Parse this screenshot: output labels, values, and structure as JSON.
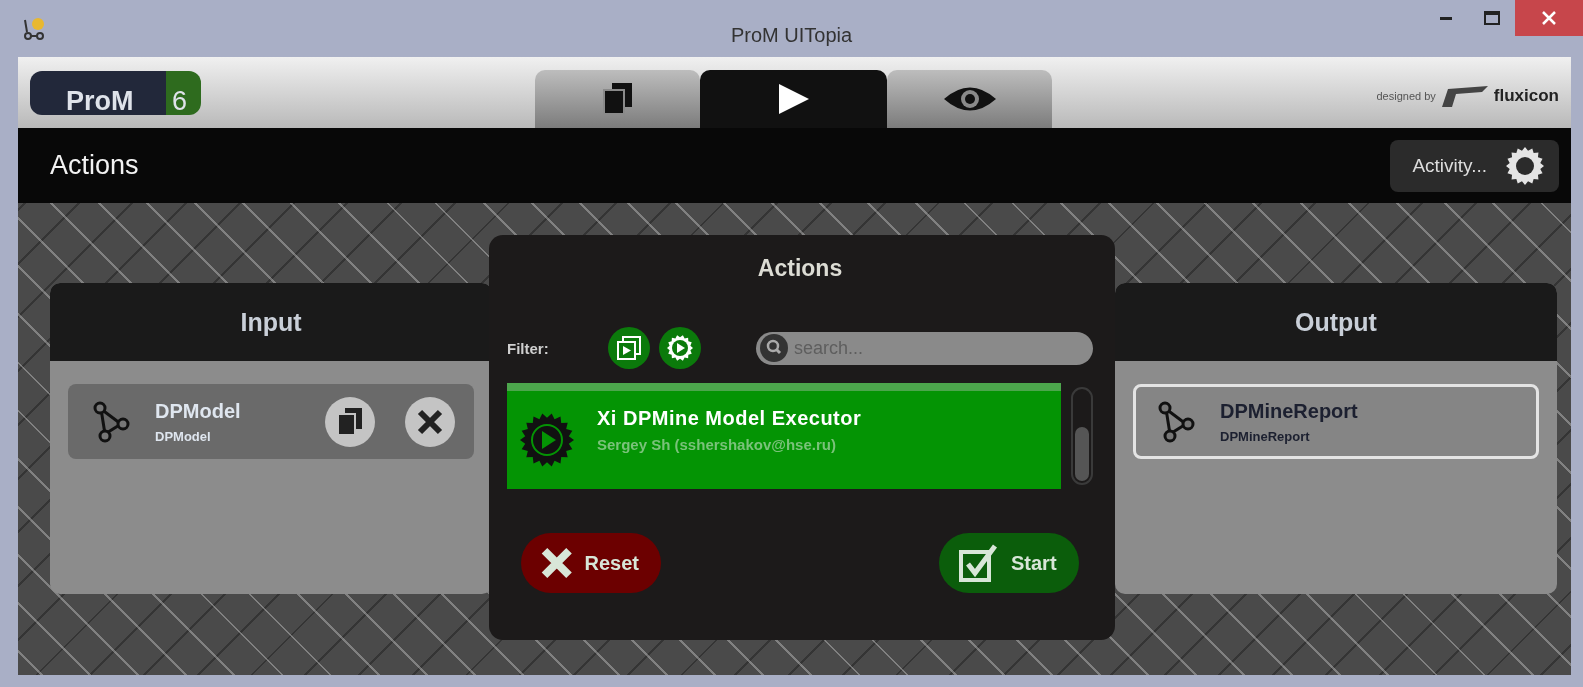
{
  "window": {
    "title": "ProM UITopia"
  },
  "logo": {
    "name": "ProM",
    "version": "6"
  },
  "tabs": [
    {
      "selected": false
    },
    {
      "selected": true
    },
    {
      "selected": false
    }
  ],
  "credit": {
    "prefix": "designed by",
    "brand": "fluxicon"
  },
  "toolbar": {
    "title": "Actions",
    "activity_button": "Activity..."
  },
  "input_panel": {
    "title": "Input",
    "items": [
      {
        "name": "DPModel",
        "type": "DPModel",
        "selected": false
      }
    ]
  },
  "output_panel": {
    "title": "Output",
    "items": [
      {
        "name": "DPMineReport",
        "type": "DPMineReport",
        "selected": true
      }
    ]
  },
  "dialog": {
    "title": "Actions",
    "filter_label": "Filter:",
    "filters": [
      {
        "on": true
      },
      {
        "on": true
      }
    ],
    "search": {
      "placeholder": "search..."
    },
    "actions": [
      {
        "name": "Xi DPMine Model Executor",
        "author": "Sergey Sh (sshershakov@hse.ru)",
        "selected": true
      }
    ],
    "buttons": [
      {
        "kind": "reset",
        "label": "Reset"
      },
      {
        "kind": "start",
        "label": "Start"
      }
    ]
  }
}
